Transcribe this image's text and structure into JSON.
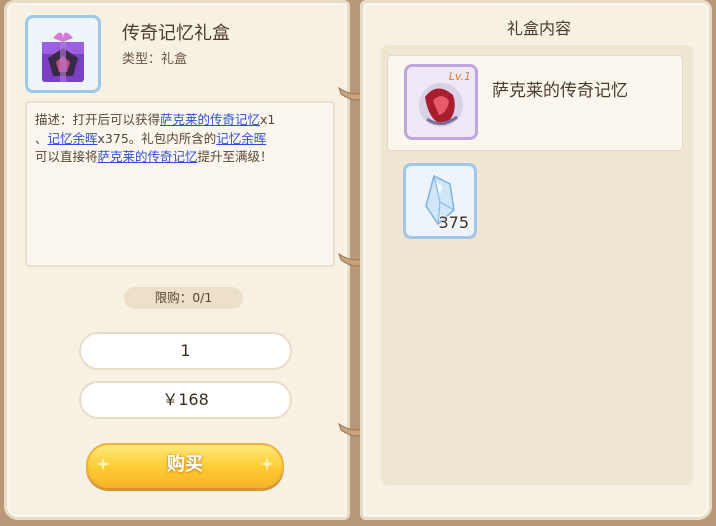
{
  "item": {
    "name": "传奇记忆礼盒",
    "type_label": "类型：礼盒",
    "icon": "gift-box-icon"
  },
  "description": {
    "prefix": "描述：打开后可以获得",
    "link1": "萨克莱的传奇记忆",
    "text1": "x1",
    "text2": "、",
    "link2": "记忆余晖",
    "text3": "x375。礼包内所含的",
    "link3": "记忆余晖",
    "text4": "可以直接将",
    "link4": "萨克莱的传奇记忆",
    "text5": "提升至满级！"
  },
  "purchase": {
    "limit": "限购：0/1",
    "quantity": "1",
    "price": "￥168",
    "buy_label": "购买"
  },
  "gift_contents": {
    "title": "礼盒内容",
    "items": [
      {
        "name": "萨克莱的传奇记忆",
        "level": "Lv.1",
        "icon": "legend-memory-icon"
      },
      {
        "count": "375",
        "icon": "crystal-shard-icon"
      }
    ]
  },
  "colors": {
    "link": "#2f4fd9",
    "button": "#ffcc33",
    "page": "#f7f1e4"
  }
}
